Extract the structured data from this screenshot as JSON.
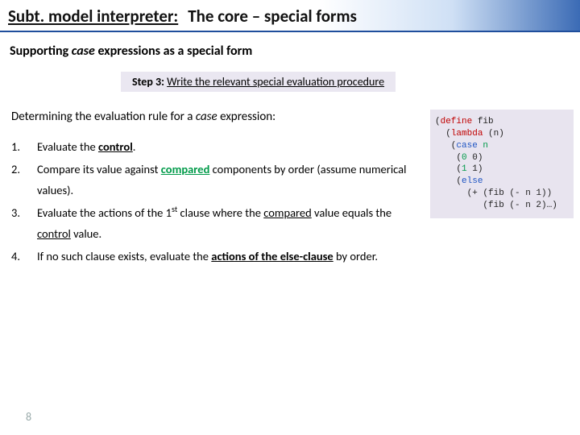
{
  "title": {
    "part1": "Subt. model interpreter:",
    "part2": "The core – special forms"
  },
  "subtitle": {
    "a": "Supporting ",
    "b": "case",
    "c": " expressions  as a special form"
  },
  "step": {
    "a": "Step 3: ",
    "b": "Write the relevant special evaluation procedure"
  },
  "heading": {
    "a": "Determining the evaluation rule for a ",
    "b": "case",
    "c": " expression:"
  },
  "items": {
    "n1": "1.",
    "t1a": "Evaluate the ",
    "t1b": "control",
    "t1c": ".",
    "n2": "2.",
    "t2a": "Compare its value against ",
    "t2b": "compared",
    "t2c": " components by order (assume numerical values).",
    "n3": "3.",
    "t3a": "Evaluate the actions of the 1",
    "t3sup": "st",
    "t3b": " clause where the ",
    "t3c": "compared",
    "t3d": " value equals the ",
    "t3e": "control",
    "t3f": " value.",
    "n4": "4.",
    "t4a": "If no such clause exists, evaluate the ",
    "t4b": "actions of the else-clause",
    "t4c": " by order."
  },
  "code": {
    "l1a": "(",
    "l1b": "define",
    "l1c": " fib",
    "l2a": "  (",
    "l2b": "lambda",
    "l2c": " (n)",
    "l3a": "   (",
    "l3b": "case",
    "l3c": " ",
    "l3d": "n",
    "l4a": "    (",
    "l4b": "0",
    "l4c": " 0)",
    "l5a": "    (",
    "l5b": "1",
    "l5c": " 1)",
    "l6a": "    (",
    "l6b": "else",
    "l7": "      (+ (fib (- n 1))",
    "l8": "         (fib (- n 2)…)"
  },
  "page": "8"
}
